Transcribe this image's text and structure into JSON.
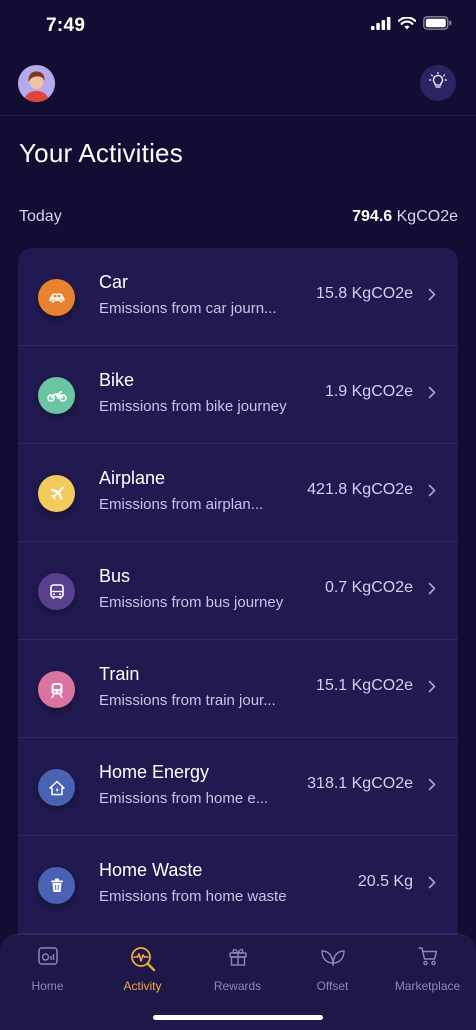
{
  "status_bar": {
    "time": "7:49"
  },
  "header": {
    "avatar_icon": "user-avatar",
    "tips_icon": "lightbulb-icon"
  },
  "page": {
    "title": "Your Activities"
  },
  "summary": {
    "label": "Today",
    "value": "794.6",
    "unit": "KgCO2e"
  },
  "activities": [
    {
      "title": "Car",
      "subtitle": "Emissions from car journ...",
      "value": "15.8 KgCO2e",
      "icon": "car-icon",
      "color": "#e8822f"
    },
    {
      "title": "Bike",
      "subtitle": "Emissions from bike journey",
      "value": "1.9 KgCO2e",
      "icon": "motorbike-icon",
      "color": "#6cc5a2"
    },
    {
      "title": "Airplane",
      "subtitle": "Emissions from airplan...",
      "value": "421.8 KgCO2e",
      "icon": "airplane-icon",
      "color": "#f1cb5c"
    },
    {
      "title": "Bus",
      "subtitle": "Emissions from bus journey",
      "value": "0.7 KgCO2e",
      "icon": "bus-icon",
      "color": "#5b3f8f"
    },
    {
      "title": "Train",
      "subtitle": "Emissions from train jour...",
      "value": "15.1 KgCO2e",
      "icon": "train-icon",
      "color": "#d9739f"
    },
    {
      "title": "Home Energy",
      "subtitle": "Emissions from home e...",
      "value": "318.1 KgCO2e",
      "icon": "home-energy-icon",
      "color": "#4a62b3"
    },
    {
      "title": "Home Waste",
      "subtitle": "Emissions from home waste",
      "value": "20.5 Kg",
      "icon": "trash-icon",
      "color": "#4a62b3"
    }
  ],
  "tabs": [
    {
      "label": "Home",
      "icon": "dashboard-icon",
      "active": false
    },
    {
      "label": "Activity",
      "icon": "activity-search-icon",
      "active": true
    },
    {
      "label": "Rewards",
      "icon": "gift-icon",
      "active": false
    },
    {
      "label": "Offset",
      "icon": "leaves-icon",
      "active": false
    },
    {
      "label": "Marketplace",
      "icon": "cart-icon",
      "active": false
    }
  ],
  "colors": {
    "background": "#120d33",
    "card": "#201a50",
    "accent": "#f2a93b",
    "tab_inactive": "#8e88b8"
  }
}
